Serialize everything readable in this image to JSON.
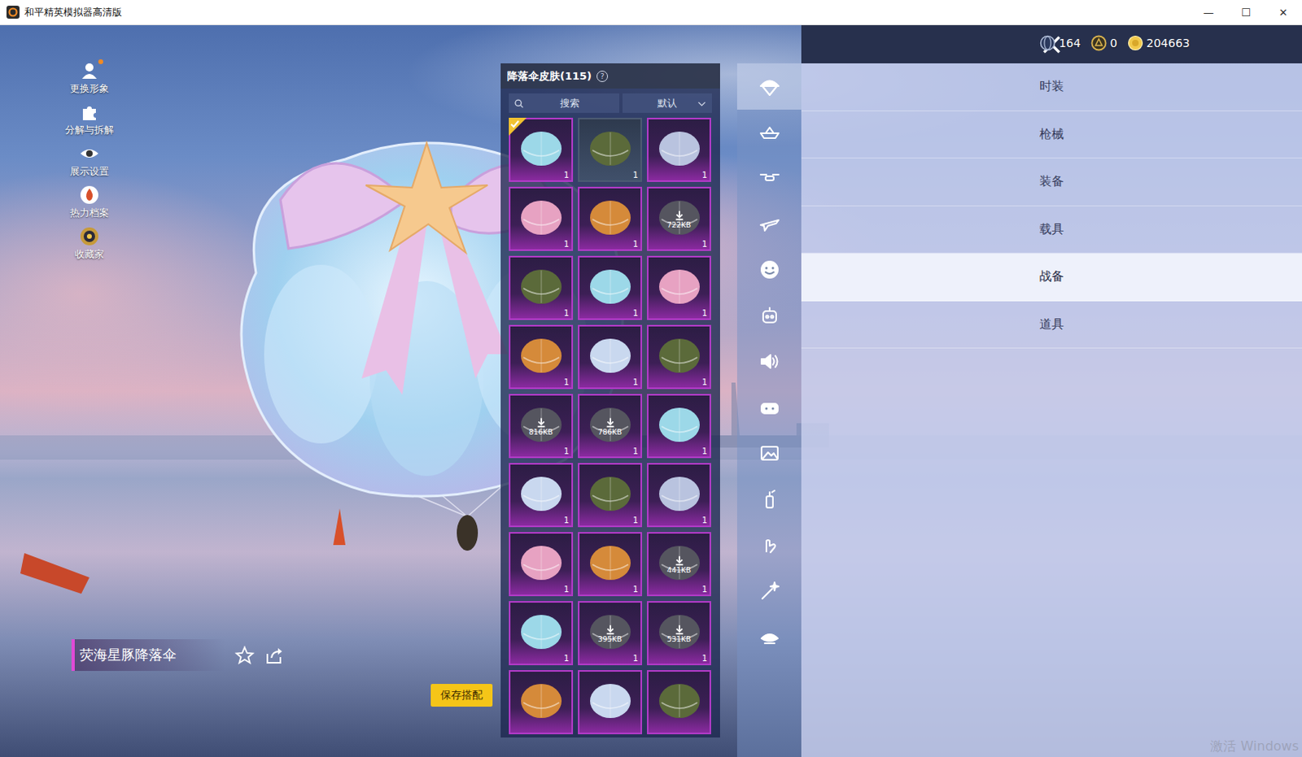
{
  "window": {
    "title": "和平精英模拟器高清版",
    "controls": [
      "—",
      "☐",
      "✕"
    ]
  },
  "side_menu": [
    {
      "label": "更换形象",
      "kind": "avatar",
      "badge": true
    },
    {
      "label": "分解与拆解",
      "kind": "puzzle",
      "badge": false
    },
    {
      "label": "展示设置",
      "kind": "eye",
      "badge": false
    },
    {
      "label": "热力档案",
      "kind": "flame",
      "badge": false
    },
    {
      "label": "收藏家",
      "kind": "medal",
      "badge": false
    }
  ],
  "currencies": [
    {
      "kind": "globe",
      "amount": "164"
    },
    {
      "kind": "coin",
      "amount": "0"
    },
    {
      "kind": "gold",
      "amount": "204663"
    }
  ],
  "panel": {
    "title": "降落伞皮肤(115)",
    "help": "?",
    "search": {
      "placeholder": "搜索"
    },
    "sort": {
      "value": "默认"
    }
  },
  "items": [
    {
      "equipped": true,
      "rarity": "purple",
      "count": "1"
    },
    {
      "equipped": false,
      "rarity": "grey",
      "count": "1"
    },
    {
      "equipped": false,
      "rarity": "purple",
      "count": "1"
    },
    {
      "equipped": false,
      "rarity": "purple",
      "count": "1"
    },
    {
      "equipped": false,
      "rarity": "purple",
      "count": "1"
    },
    {
      "equipped": false,
      "rarity": "purple",
      "count": "1",
      "download": "722KB"
    },
    {
      "equipped": false,
      "rarity": "purple",
      "count": "1"
    },
    {
      "equipped": false,
      "rarity": "purple",
      "count": "1"
    },
    {
      "equipped": false,
      "rarity": "purple",
      "count": "1"
    },
    {
      "equipped": false,
      "rarity": "purple",
      "count": "1"
    },
    {
      "equipped": false,
      "rarity": "purple",
      "count": "1"
    },
    {
      "equipped": false,
      "rarity": "purple",
      "count": "1"
    },
    {
      "equipped": false,
      "rarity": "purple",
      "count": "1",
      "download": "816KB"
    },
    {
      "equipped": false,
      "rarity": "purple",
      "count": "1",
      "download": "786KB"
    },
    {
      "equipped": false,
      "rarity": "purple",
      "count": "1"
    },
    {
      "equipped": false,
      "rarity": "purple",
      "count": "1"
    },
    {
      "equipped": false,
      "rarity": "purple",
      "count": "1"
    },
    {
      "equipped": false,
      "rarity": "purple",
      "count": "1"
    },
    {
      "equipped": false,
      "rarity": "purple",
      "count": "1"
    },
    {
      "equipped": false,
      "rarity": "purple",
      "count": "1"
    },
    {
      "equipped": false,
      "rarity": "purple",
      "count": "1",
      "download": "441KB"
    },
    {
      "equipped": false,
      "rarity": "purple",
      "count": "1"
    },
    {
      "equipped": false,
      "rarity": "purple",
      "count": "1",
      "download": "395KB"
    },
    {
      "equipped": false,
      "rarity": "purple",
      "count": "1",
      "download": "531KB"
    },
    {
      "equipped": false,
      "rarity": "purple"
    },
    {
      "equipped": false,
      "rarity": "purple"
    },
    {
      "equipped": false,
      "rarity": "purple"
    }
  ],
  "categories": [
    {
      "kind": "parachute",
      "selected": true
    },
    {
      "kind": "boat",
      "selected": false
    },
    {
      "kind": "drone",
      "selected": false
    },
    {
      "kind": "plane",
      "selected": false
    },
    {
      "kind": "smile",
      "selected": false
    },
    {
      "kind": "robot",
      "selected": false
    },
    {
      "kind": "speaker",
      "selected": false
    },
    {
      "kind": "gamepad",
      "selected": false
    },
    {
      "kind": "picture",
      "selected": false
    },
    {
      "kind": "spray",
      "selected": false
    },
    {
      "kind": "hand",
      "selected": false
    },
    {
      "kind": "wand",
      "selected": false
    },
    {
      "kind": "bird",
      "selected": false
    }
  ],
  "tabs": [
    {
      "label": "时装",
      "selected": false
    },
    {
      "label": "枪械",
      "selected": false
    },
    {
      "label": "装备",
      "selected": false
    },
    {
      "label": "载具",
      "selected": false
    },
    {
      "label": "战备",
      "selected": true
    },
    {
      "label": "道具",
      "selected": false
    }
  ],
  "preview": {
    "name": "荧海星豚降落伞"
  },
  "save_button": "保存搭配",
  "watermark": "激活 Windows"
}
